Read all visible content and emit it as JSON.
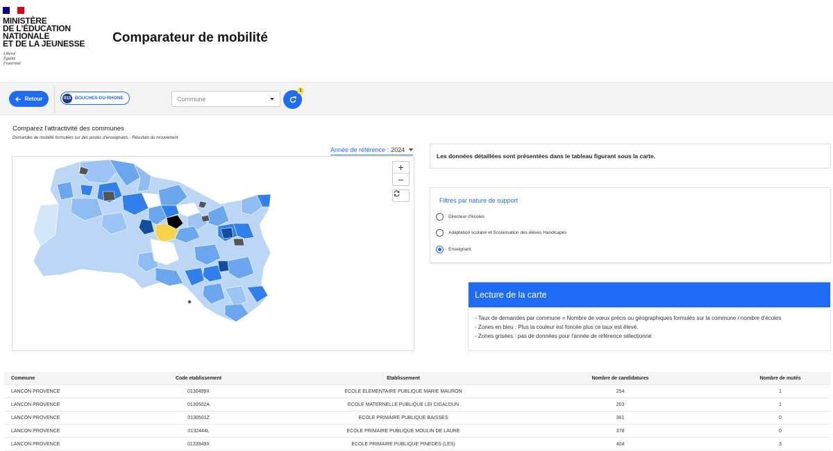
{
  "header": {
    "flag_colors": [
      "#000091",
      "#ffffff",
      "#e1000f"
    ],
    "ministry_lines": "MINISTÈRE\nDE L'ÉDUCATION\nNATIONALE\nET DE LA JEUNESSE",
    "motto": "Liberté\nÉgalité\nFraternité",
    "app_title": "Comparateur de mobilité"
  },
  "toolbar": {
    "back_label": "Retour",
    "department_code": "013",
    "department_name": "BOUCHES-DU-RHONE",
    "commune_placeholder": "Commune",
    "refresh_badge": "1"
  },
  "main": {
    "title": "Comparez l'attractivité des communes",
    "subtitle": "Demandes de mobilité formulées sur des postes d'enseignants - Résultats du mouvement",
    "year_label": "Année de référence :",
    "year_value": "2024"
  },
  "map": {
    "zoom_in": "+",
    "zoom_out": "−",
    "legend_colors": {
      "light": "#bcd7f6",
      "mid": "#6aa7ef",
      "strong": "#2f80ed",
      "dark": "#134d9e",
      "selected": "#f7d54a",
      "no_data": "#555555",
      "max": "#000000"
    }
  },
  "info": {
    "text": "Les données détaillées sont présentées dans le tableau figurant sous la carte."
  },
  "filters": {
    "title": "Filtres par nature de support",
    "options": [
      {
        "label": "Directeur d'écoles",
        "selected": false
      },
      {
        "label": "Adaptation scolaire et Scolarisation des élèves Handicapés",
        "selected": false
      },
      {
        "label": "Enseignant",
        "selected": true
      }
    ]
  },
  "lecture": {
    "title": "Lecture de la carte",
    "lines": [
      "- Taux de demandes par commune = Nombre de vœux précis ou géographiques formulés sur la commune / nombre d'écoles",
      "- Zones en bleu : Plus la couleur est foncée plus ce taux est élevé.",
      "- Zones grisées : pas de données pour l'année de référence sélectionné"
    ]
  },
  "table": {
    "headers": [
      "Commune",
      "Code etablissement",
      "Etablissement",
      "Nombre de candidatures",
      "Nombre de mutés"
    ],
    "rows": [
      [
        "LANCON PROVENCE",
        "0130499X",
        "ECOLE ELEMENTAIRE PUBLIQUE MARIE MAURON",
        "254",
        "1"
      ],
      [
        "LANCON PROVENCE",
        "0130502A",
        "ECOLE MATERNELLE PUBLIQUE LEI CIGALOUN",
        "203",
        "1"
      ],
      [
        "LANCON PROVENCE",
        "0130501Z",
        "ECOLE PRIMAIRE PUBLIQUE BAISSES",
        "361",
        "0"
      ],
      [
        "LANCON PROVENCE",
        "0132444L",
        "ECOLE PRIMAIRE PUBLIQUE MOULIN DE LAURE",
        "378",
        "0"
      ],
      [
        "LANCON PROVENCE",
        "0133949X",
        "ECOLE PRIMAIRE PUBLIQUE PINEDES (LES)",
        "404",
        "3"
      ]
    ]
  }
}
